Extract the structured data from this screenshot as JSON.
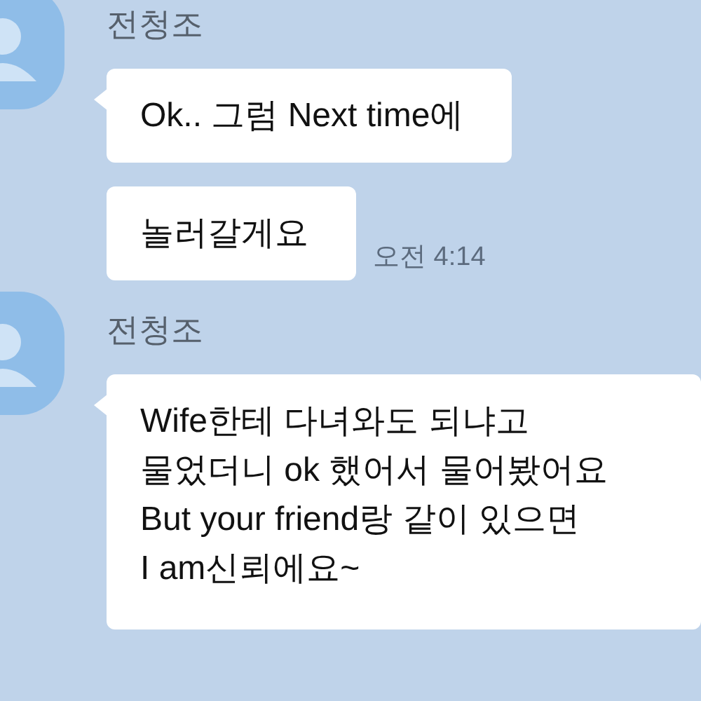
{
  "messages": [
    {
      "sender": "전청조",
      "bubbles": [
        {
          "text": "Ok.. 그럼 Next time에"
        },
        {
          "text": "놀러갈게요",
          "time": "오전 4:14"
        }
      ]
    },
    {
      "sender": "전청조",
      "bubbles": [
        {
          "text": "Wife한테 다녀와도 되냐고\n물었더니 ok 했어서 물어봤어요\nBut your friend랑 같이 있으면\nI am신뢰에요~"
        }
      ]
    }
  ]
}
